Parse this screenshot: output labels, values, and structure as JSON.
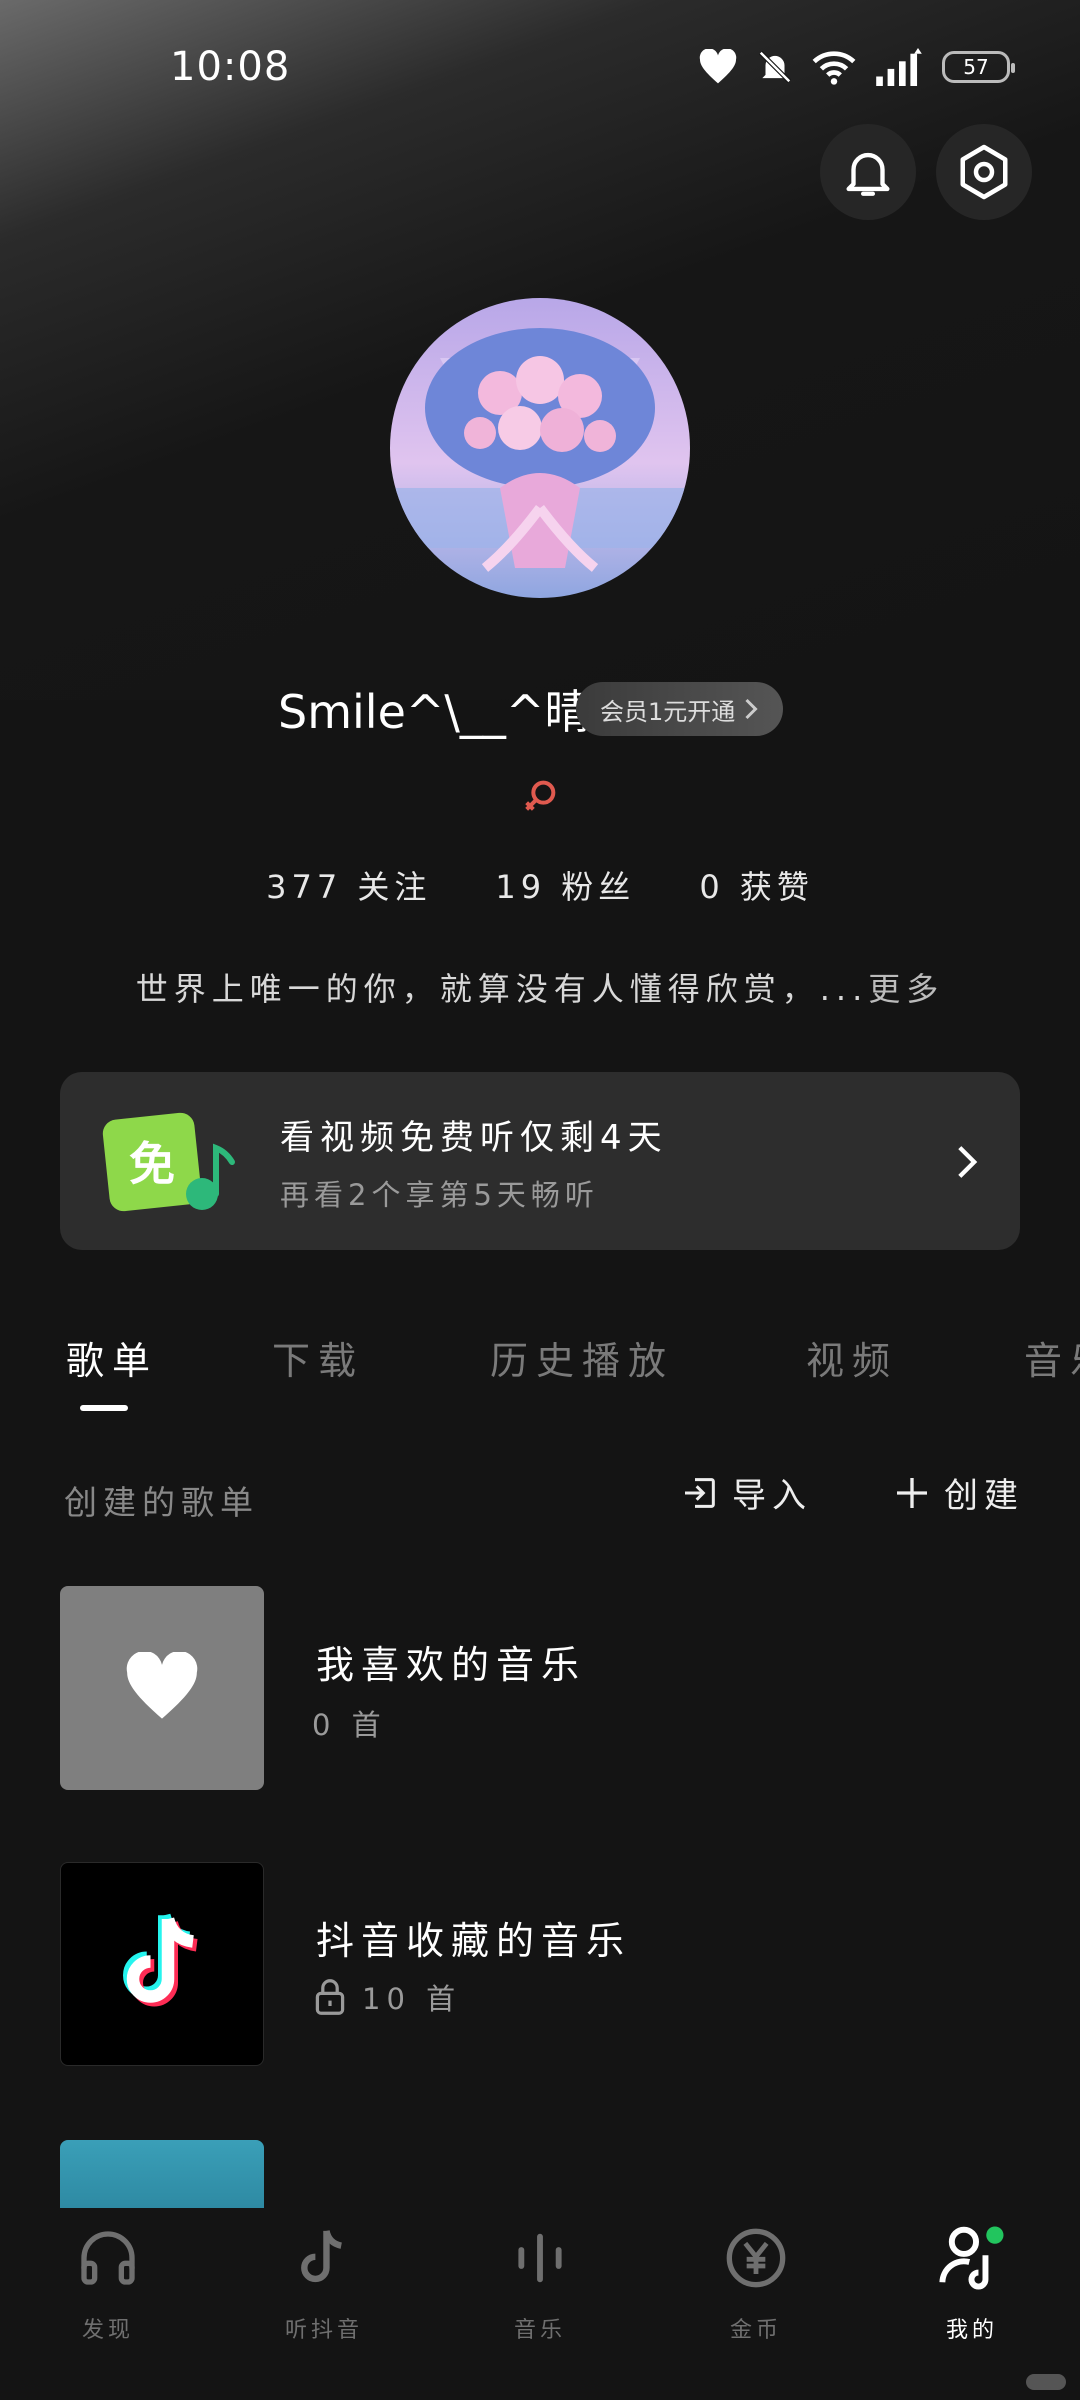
{
  "status_bar": {
    "time": "10:08",
    "battery": "57"
  },
  "profile": {
    "username": "Smile^\\__^晴",
    "vip_badge": "会员1元开通",
    "stats": [
      {
        "count": "377",
        "label": "关注"
      },
      {
        "count": "19",
        "label": "粉丝"
      },
      {
        "count": "0",
        "label": "获赞"
      }
    ],
    "bio": "世界上唯一的你，就算没有人懂得欣赏，...",
    "bio_more": "更多"
  },
  "promo": {
    "icon_text": "免",
    "title": "看视频免费听仅剩4天",
    "subtitle": "再看2个享第5天畅听"
  },
  "tabs": [
    "歌单",
    "下载",
    "历史播放",
    "视频",
    "音乐"
  ],
  "playlists_section": {
    "title": "创建的歌单",
    "import_label": "导入",
    "create_label": "创建"
  },
  "playlists": [
    {
      "name": "我喜欢的音乐",
      "count": "0 首"
    },
    {
      "name": "抖音收藏的音乐",
      "count": "10 首"
    }
  ],
  "bottom_nav": [
    "发现",
    "听抖音",
    "音乐",
    "金币",
    "我的"
  ],
  "colors": {
    "background": "#141414",
    "card": "#2d2d2d",
    "accent_green": "#22c55e",
    "gender_icon": "#e05a4f"
  }
}
